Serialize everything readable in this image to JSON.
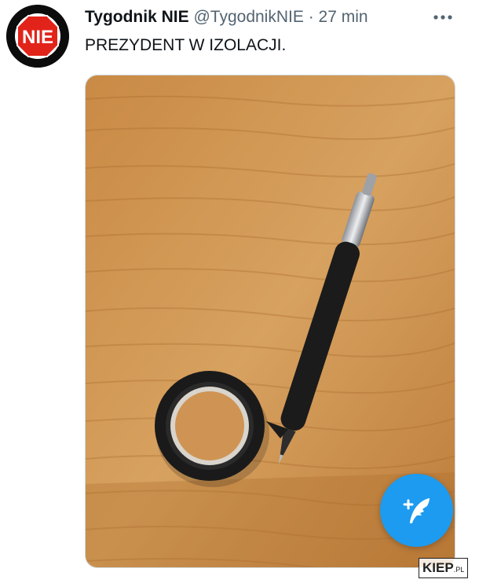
{
  "tweet": {
    "avatar_text": "NIE",
    "author_name": "Tygodnik NIE",
    "author_handle": "@TygodnikNIE",
    "separator": "·",
    "timestamp": "27 min",
    "text": "PREZYDENT W IZOLACJI."
  },
  "colors": {
    "accent": "#1d9bf0",
    "avatar_red": "#e2231a"
  },
  "icons": {
    "more": "more-horizontal-icon",
    "compose": "compose-tweet-icon"
  },
  "watermark": {
    "main": "KIEP",
    "suffix": ".PL"
  }
}
